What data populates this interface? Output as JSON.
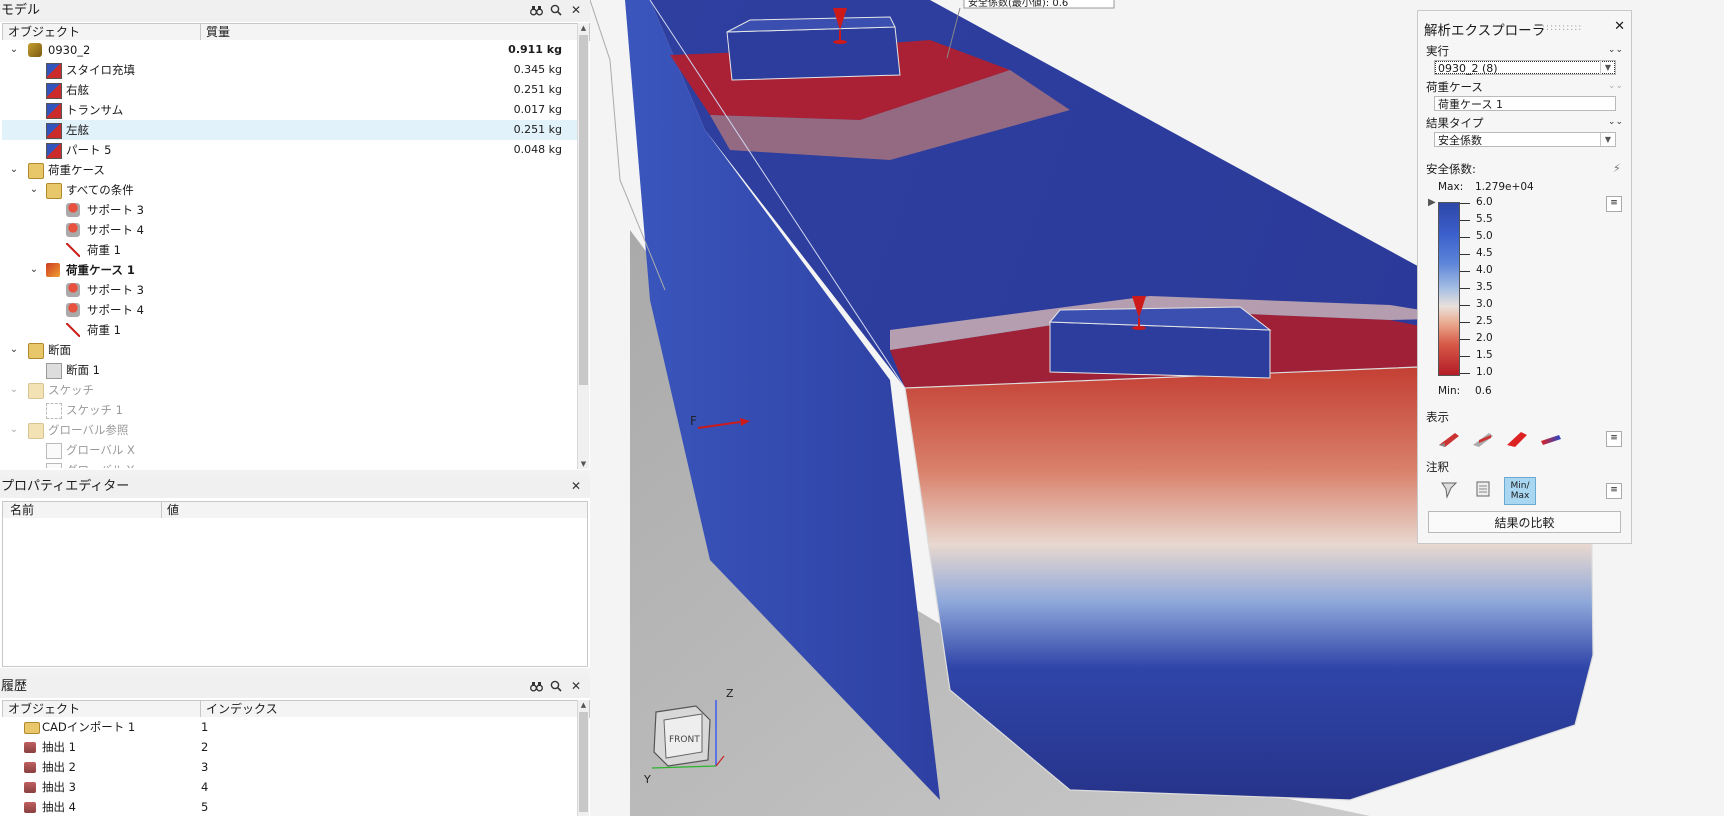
{
  "model_panel": {
    "title": "モデル",
    "col_object": "オブジェクト",
    "col_mass": "質量",
    "rows": [
      {
        "label": "0930_2",
        "mass": "0.911 kg",
        "icon": "model-icon"
      },
      {
        "label": "スタイロ充填",
        "mass": "0.345 kg",
        "icon": "part-icon"
      },
      {
        "label": "右舷",
        "mass": "0.251 kg",
        "icon": "part-icon"
      },
      {
        "label": "トランサム",
        "mass": "0.017 kg",
        "icon": "part-icon"
      },
      {
        "label": "左舷",
        "mass": "0.251 kg",
        "icon": "part-icon"
      },
      {
        "label": "パート 5",
        "mass": "0.048 kg",
        "icon": "part-icon"
      },
      {
        "label": "荷重ケース",
        "icon": "folder-icon"
      },
      {
        "label": "すべての条件",
        "icon": "folder-icon"
      },
      {
        "label": "サポート 3",
        "icon": "support-icon"
      },
      {
        "label": "サポート 4",
        "icon": "support-icon"
      },
      {
        "label": "荷重 1",
        "icon": "load-icon"
      },
      {
        "label": "荷重ケース 1",
        "icon": "loadcase-icon"
      },
      {
        "label": "サポート 3",
        "icon": "support-icon"
      },
      {
        "label": "サポート 4",
        "icon": "support-icon"
      },
      {
        "label": "荷重 1",
        "icon": "load-icon"
      },
      {
        "label": "断面",
        "icon": "folder-icon"
      },
      {
        "label": "断面 1",
        "icon": "section-icon"
      },
      {
        "label": "スケッチ",
        "icon": "folder-icon"
      },
      {
        "label": "スケッチ 1",
        "icon": "sketch-icon"
      },
      {
        "label": "グローバル参照",
        "icon": "folder-icon"
      },
      {
        "label": "グローバル X",
        "icon": "global-icon"
      },
      {
        "label": "グローバル Y",
        "icon": "global-icon"
      }
    ]
  },
  "property_panel": {
    "title": "プロパティエディター",
    "col_name": "名前",
    "col_value": "値"
  },
  "history_panel": {
    "title": "履歴",
    "col_object": "オブジェクト",
    "col_index": "インデックス",
    "rows": [
      {
        "label": "CADインポート 1",
        "index": "1",
        "icon": "folder-icon"
      },
      {
        "label": "抽出 1",
        "index": "2",
        "icon": "extract-icon"
      },
      {
        "label": "抽出 2",
        "index": "3",
        "icon": "extract-icon"
      },
      {
        "label": "抽出 3",
        "index": "4",
        "icon": "extract-icon"
      },
      {
        "label": "抽出 4",
        "index": "5",
        "icon": "extract-icon"
      }
    ]
  },
  "viewport": {
    "callout": "安全係数(最小値): 0.6",
    "force_label": "F",
    "viewcube_face": "FRONT",
    "axis_z": "Z",
    "axis_y": "Y"
  },
  "explorer": {
    "title": "解析エクスプローラ",
    "run_label": "実行",
    "run_value": "0930_2 (8)",
    "loadcase_label": "荷重ケース",
    "loadcase_value": "荷重ケース 1",
    "resulttype_label": "結果タイプ",
    "resulttype_value": "安全係数",
    "legend_title": "安全係数:",
    "max_label": "Max:",
    "max_value": "1.279e+04",
    "min_label": "Min:",
    "min_value": "0.6",
    "ticks": [
      "6.0",
      "5.5",
      "5.0",
      "4.5",
      "4.0",
      "3.5",
      "3.0",
      "2.5",
      "2.0",
      "1.5",
      "1.0"
    ],
    "display_label": "表示",
    "annotation_label": "注釈",
    "minmax_label": "Min/\nMax",
    "compare_button": "結果の比較"
  }
}
